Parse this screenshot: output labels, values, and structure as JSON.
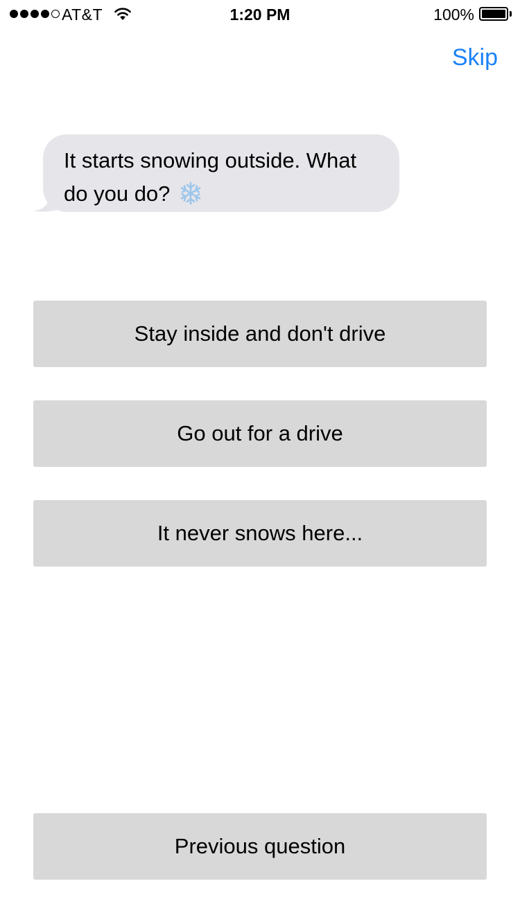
{
  "status_bar": {
    "carrier": "AT&T",
    "time": "1:20 PM",
    "battery": "100%",
    "signal_bars_filled": 4,
    "signal_bars_total": 5
  },
  "header": {
    "skip_label": "Skip",
    "accent_color": "#1a82f7"
  },
  "question": {
    "text": "It starts snowing outside. What do you do?",
    "icon": "snowflake-icon"
  },
  "answers": [
    {
      "label": "Stay inside and don't drive"
    },
    {
      "label": "Go out for a drive"
    },
    {
      "label": "It never snows here..."
    }
  ],
  "footer": {
    "previous_label": "Previous question"
  }
}
